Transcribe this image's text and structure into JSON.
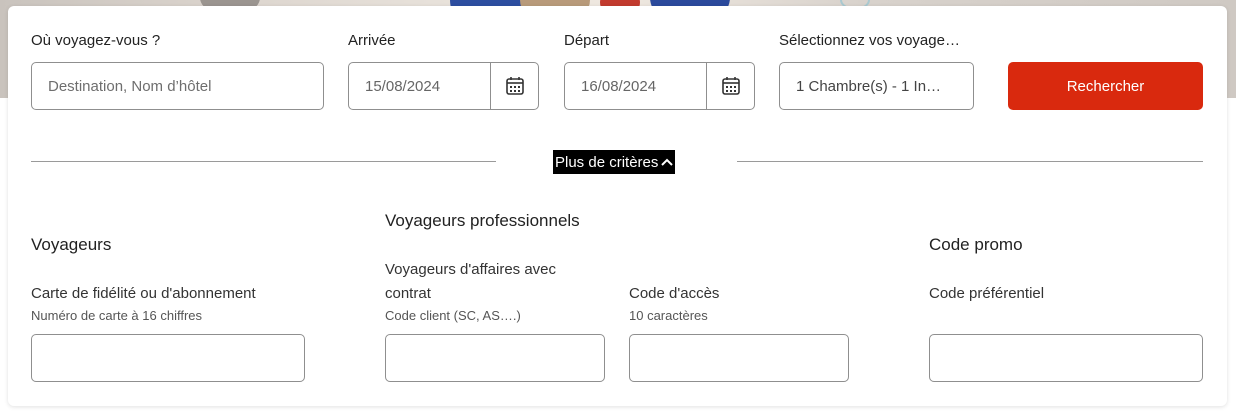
{
  "search": {
    "destination_label": "Où voyagez-vous ?",
    "destination_placeholder": "Destination, Nom d’hôtel",
    "arrival_label": "Arrivée",
    "arrival_value": "15/08/2024",
    "departure_label": "Départ",
    "departure_value": "16/08/2024",
    "travelers_label": "Sélectionnez vos voyage…",
    "travelers_value": "1 Chambre(s) - 1 In…",
    "search_button": "Rechercher"
  },
  "more_criteria": {
    "label": "Plus de critères",
    "icon": "chevron-up-icon"
  },
  "voyageurs": {
    "title": "Voyageurs",
    "loyalty_label": "Carte de fidélité ou d'abonnement",
    "loyalty_hint": "Numéro de carte à 16 chiffres"
  },
  "professional": {
    "title": "Voyageurs professionnels",
    "contract_label_line1": "Voyageurs d'affaires avec",
    "contract_label_line2": "contrat",
    "contract_hint": "Code client (SC, AS….)",
    "access_label": "Code d'accès",
    "access_hint": "10 caractères"
  },
  "promo": {
    "title": "Code promo",
    "preferential_label": "Code préférentiel"
  },
  "colors": {
    "accent": "#d9290e",
    "border": "#8f8f8f"
  }
}
